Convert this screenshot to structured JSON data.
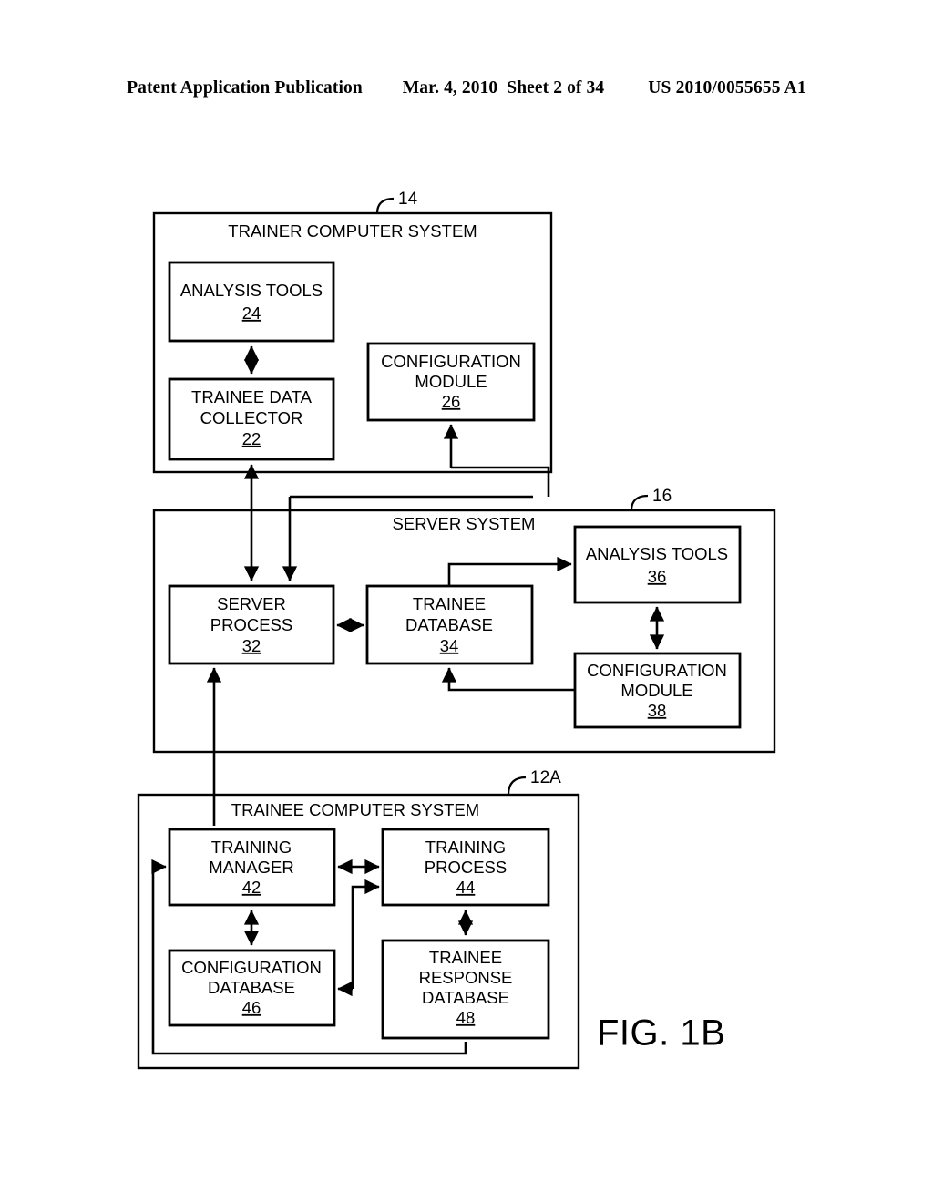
{
  "header": {
    "publication": "Patent Application Publication",
    "date": "Mar. 4, 2010",
    "sheet": "Sheet 2 of 34",
    "patent_number": "US 2010/0055655 A1"
  },
  "figure": {
    "caption": "FIG. 1B",
    "systems": [
      {
        "id": "trainer",
        "title": "TRAINER COMPUTER SYSTEM",
        "ref": "14",
        "blocks": [
          {
            "id": "analysis-tools-24",
            "line1": "ANALYSIS TOOLS",
            "line2": "",
            "line3": "",
            "ref": "24"
          },
          {
            "id": "trainee-data-collector-22",
            "line1": "TRAINEE DATA",
            "line2": "COLLECTOR",
            "line3": "",
            "ref": "22"
          },
          {
            "id": "configuration-module-26",
            "line1": "CONFIGURATION",
            "line2": "MODULE",
            "line3": "",
            "ref": "26"
          }
        ]
      },
      {
        "id": "server",
        "title": "SERVER SYSTEM",
        "ref": "16",
        "blocks": [
          {
            "id": "server-process-32",
            "line1": "SERVER",
            "line2": "PROCESS",
            "line3": "",
            "ref": "32"
          },
          {
            "id": "trainee-database-34",
            "line1": "TRAINEE",
            "line2": "DATABASE",
            "line3": "",
            "ref": "34"
          },
          {
            "id": "analysis-tools-36",
            "line1": "ANALYSIS TOOLS",
            "line2": "",
            "line3": "",
            "ref": "36"
          },
          {
            "id": "configuration-module-38",
            "line1": "CONFIGURATION",
            "line2": "MODULE",
            "line3": "",
            "ref": "38"
          }
        ]
      },
      {
        "id": "trainee",
        "title": "TRAINEE COMPUTER SYSTEM",
        "ref": "12A",
        "blocks": [
          {
            "id": "training-manager-42",
            "line1": "TRAINING",
            "line2": "MANAGER",
            "line3": "",
            "ref": "42"
          },
          {
            "id": "training-process-44",
            "line1": "TRAINING",
            "line2": "PROCESS",
            "line3": "",
            "ref": "44"
          },
          {
            "id": "configuration-database-46",
            "line1": "CONFIGURATION",
            "line2": "DATABASE",
            "line3": "",
            "ref": "46"
          },
          {
            "id": "trainee-response-database-48",
            "line1": "TRAINEE",
            "line2": "RESPONSE",
            "line3": "DATABASE",
            "ref": "48"
          }
        ]
      }
    ]
  }
}
